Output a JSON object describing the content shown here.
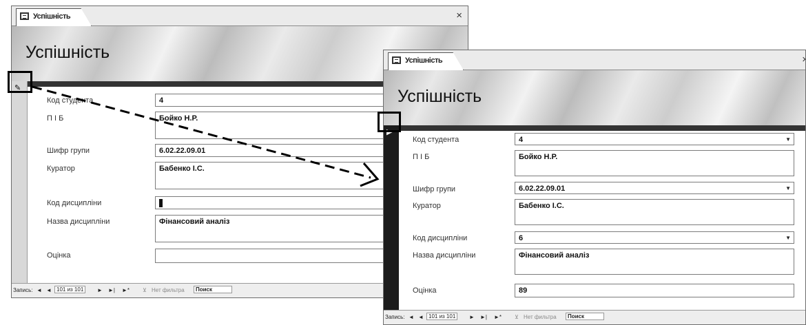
{
  "form_tab_label": "Успішність",
  "close_glyph": "×",
  "form_title": "Успішність",
  "row_marker_edit": "✎",
  "row_marker_current": "▶",
  "dropdown_glyph": "▼",
  "fields": {
    "student_code": {
      "label": "Код студента",
      "value": "4"
    },
    "full_name": {
      "label": "П І Б",
      "value": "Бойко Н.Р."
    },
    "group_code": {
      "label": "Шифр групи",
      "value": "6.02.22.09.01"
    },
    "curator": {
      "label": "Куратор",
      "value": "Бабенко І.С."
    },
    "discipline_code": {
      "label": "Код дисципліни",
      "value_before": "",
      "value_after": "6"
    },
    "discipline_name": {
      "label": "Назва дисципліни",
      "value": "Фінансовий аналіз"
    },
    "grade": {
      "label": "Оцінка",
      "value_before": "",
      "value_after": "89"
    }
  },
  "status_bar": {
    "record_label": "Запись:",
    "first_btn": "◄",
    "prev_btn": "◄",
    "record_position": "101 из 101",
    "next_btn": "►",
    "last_btn": "►|",
    "new_btn": "►*",
    "filter_label": "Нет фильтра",
    "search_label": "Поиск"
  }
}
